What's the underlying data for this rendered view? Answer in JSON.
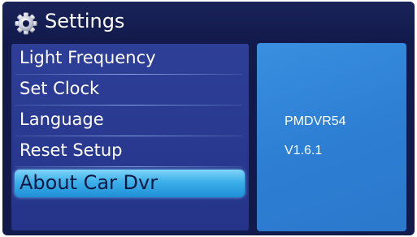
{
  "header": {
    "title": "Settings",
    "icon": "gear-icon"
  },
  "menu": {
    "items": [
      {
        "label": "Light Frequency",
        "selected": false
      },
      {
        "label": "Set Clock",
        "selected": false
      },
      {
        "label": "Language",
        "selected": false
      },
      {
        "label": "Reset Setup",
        "selected": false
      },
      {
        "label": "About Car Dvr",
        "selected": true
      }
    ]
  },
  "info": {
    "model": "PMDVR54",
    "version": "V1.6.1"
  },
  "colors": {
    "background": "#121a4c",
    "menu_background": "#2e3f98",
    "selection_highlight": "#3cb0ea",
    "info_panel": "#2d7fd4",
    "text": "#ffffff"
  }
}
